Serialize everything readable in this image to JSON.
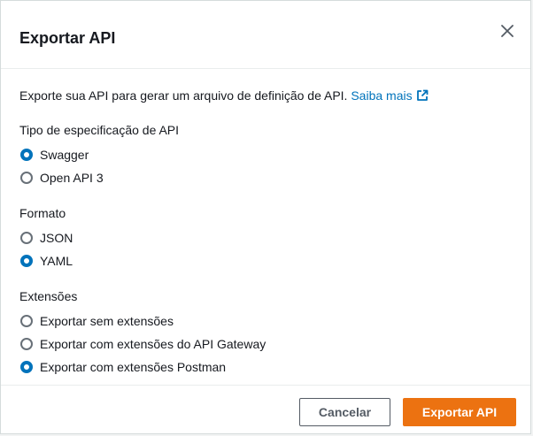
{
  "dialog": {
    "title": "Exportar API",
    "intro_text": "Exporte sua API para gerar um arquivo de definição de API.",
    "learn_more_label": "Saiba mais",
    "link_color": "#0073bb"
  },
  "groups": [
    {
      "label": "Tipo de especificação de API",
      "options": [
        {
          "label": "Swagger",
          "checked": true
        },
        {
          "label": "Open API 3",
          "checked": false
        }
      ]
    },
    {
      "label": "Formato",
      "options": [
        {
          "label": "JSON",
          "checked": false
        },
        {
          "label": "YAML",
          "checked": true
        }
      ]
    },
    {
      "label": "Extensões",
      "options": [
        {
          "label": "Exportar sem extensões",
          "checked": false
        },
        {
          "label": "Exportar com extensões do API Gateway",
          "checked": false
        },
        {
          "label": "Exportar com extensões Postman",
          "checked": true
        }
      ]
    }
  ],
  "footer": {
    "cancel_label": "Cancelar",
    "export_label": "Exportar API",
    "primary_color": "#ec7211"
  },
  "icons": {
    "close": "close-icon",
    "external_link": "external-link-icon"
  }
}
